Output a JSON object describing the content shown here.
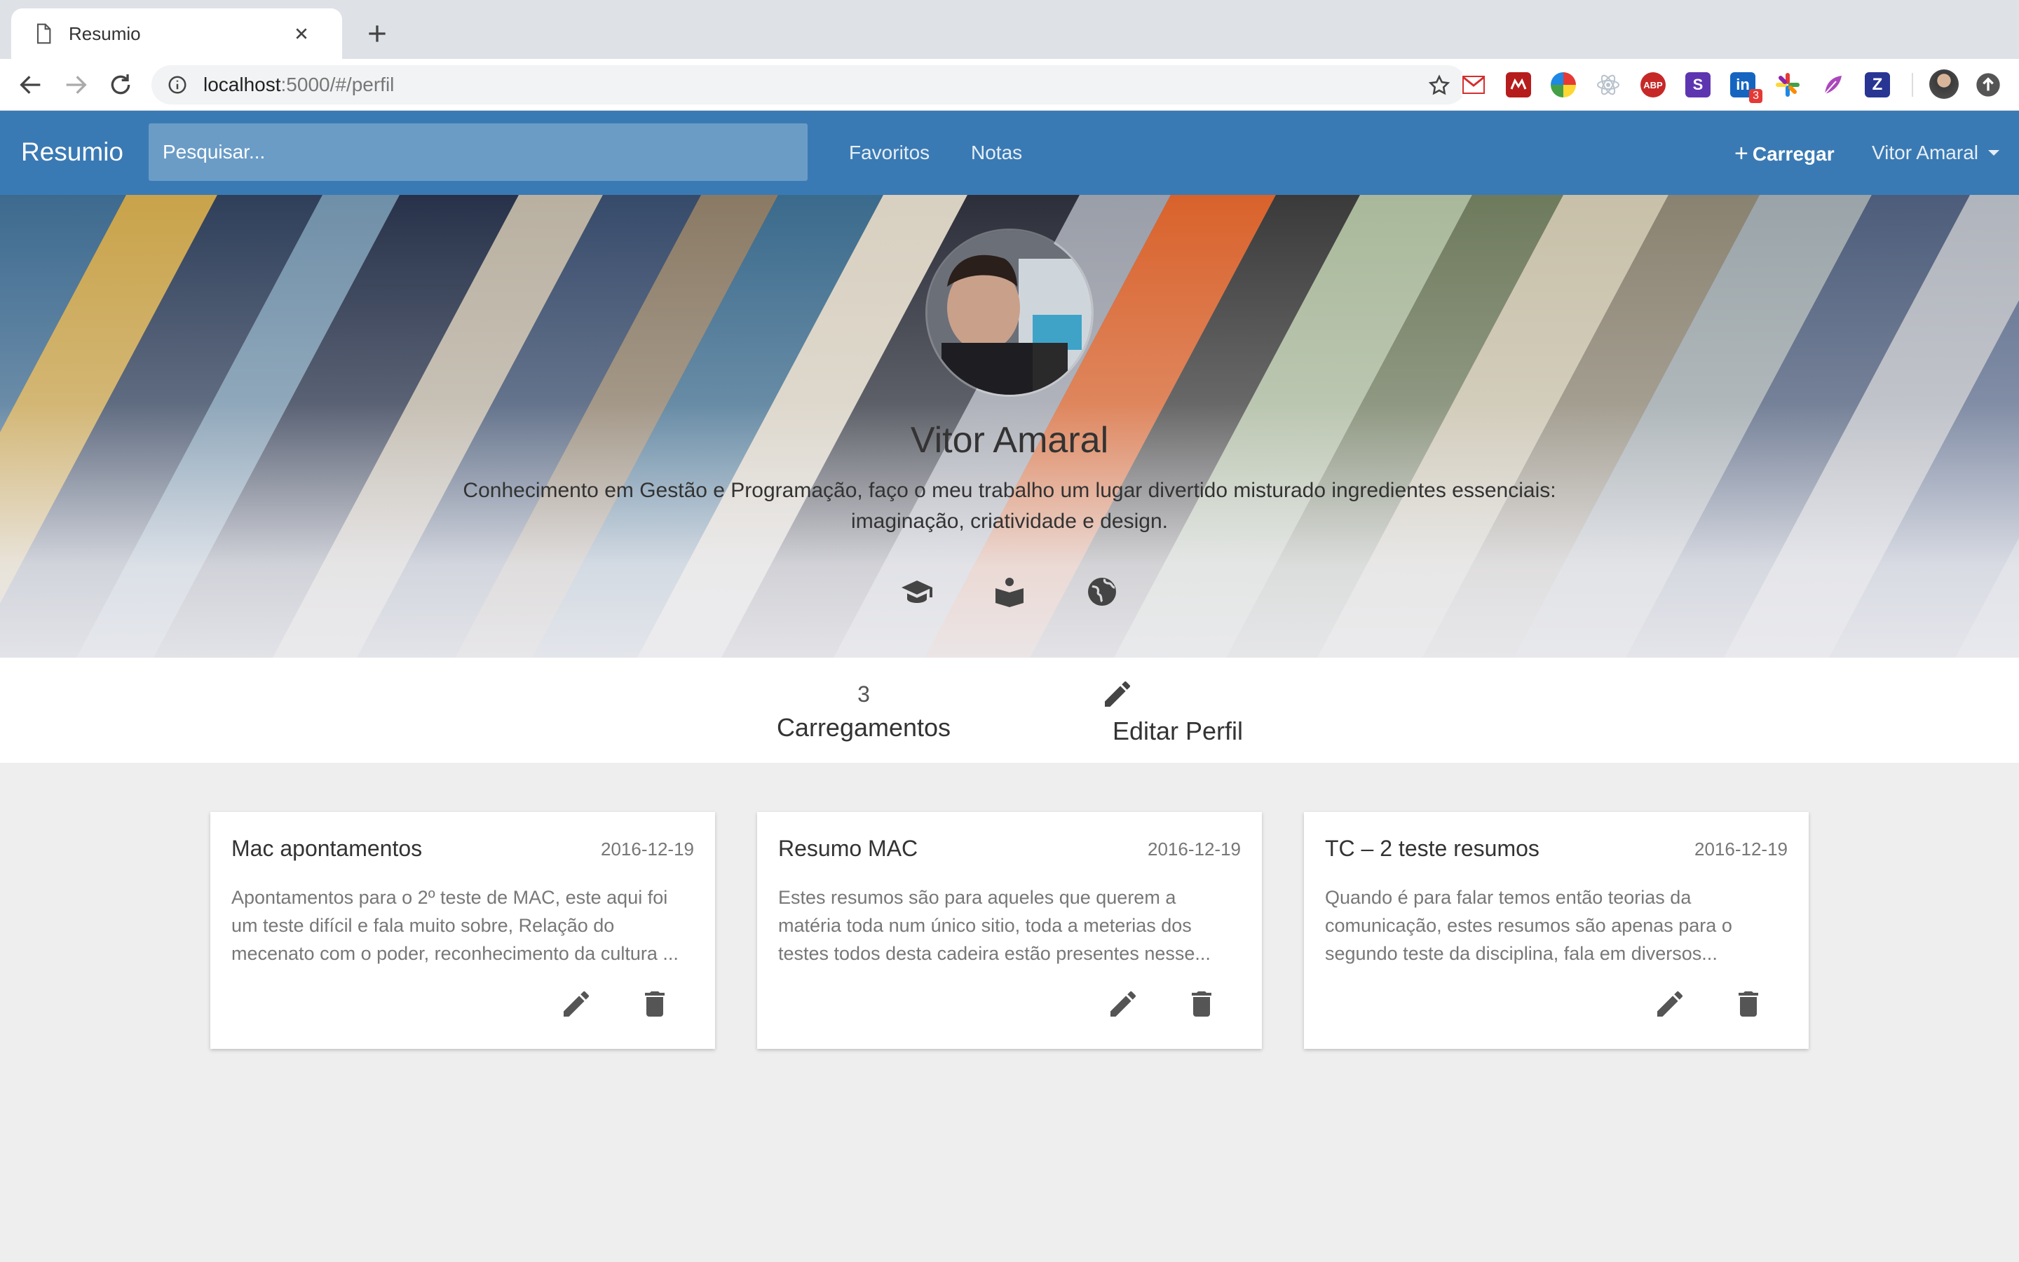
{
  "browser": {
    "tab_title": "Resumio",
    "url_host": "localhost",
    "url_rest": ":5000/#/perfil",
    "extensions": [
      {
        "name": "gmail-extension-icon",
        "color": "#ffffff"
      },
      {
        "name": "mendeley-extension-icon",
        "color": "#b71c1c"
      },
      {
        "name": "color-picker-extension-icon",
        "color": "#4caf50"
      },
      {
        "name": "react-devtools-extension-icon",
        "color": "#c8d0d8"
      },
      {
        "name": "adblock-plus-extension-icon",
        "color": "#c62828",
        "label": "ABP"
      },
      {
        "name": "s-extension-icon",
        "color": "#5e35b1",
        "label": "S"
      },
      {
        "name": "linkedin-extension-icon",
        "color": "#1565c0",
        "label": "in",
        "badge": "3"
      },
      {
        "name": "asterisk-extension-icon",
        "color": "#e53935"
      },
      {
        "name": "feather-extension-icon",
        "color": "#ab47bc"
      },
      {
        "name": "zotero-extension-icon",
        "color": "#283593",
        "label": "Z"
      }
    ]
  },
  "navbar": {
    "brand": "Resumio",
    "search_placeholder": "Pesquisar...",
    "links": [
      "Favoritos",
      "Notas"
    ],
    "upload_label": "Carregar",
    "user_name": "Vitor Amaral",
    "color": "#3a7ab4"
  },
  "profile": {
    "name": "Vitor Amaral",
    "bio_line1": "Conhecimento em Gestão e Programação, faço o meu trabalho um lugar divertido misturado ingredientes essenciais:",
    "bio_line2": "imaginação, criatividade e design.",
    "icons": [
      "graduation-cap-icon",
      "reading-book-icon",
      "globe-icon"
    ]
  },
  "stats": {
    "uploads_count": "3",
    "uploads_label": "Carregamentos",
    "edit_label": "Editar Perfil"
  },
  "cards": [
    {
      "title": "Mac apontamentos",
      "date": "2016-12-19",
      "text": "Apontamentos para o 2º teste de MAC, este aqui foi um teste difícil e fala muito sobre, Relação do mecenato com o poder, reconhecimento da cultura ..."
    },
    {
      "title": "Resumo MAC",
      "date": "2016-12-19",
      "text": "Estes resumos são para aqueles que querem a matéria toda num único sitio, toda a meterias dos testes todos desta cadeira estão presentes nesse..."
    },
    {
      "title": "TC – 2 teste resumos",
      "date": "2016-12-19",
      "text": "Quando é para falar temos então teorias da comunicação, estes resumos são apenas para o segundo teste da disciplina, fala em diversos..."
    }
  ]
}
